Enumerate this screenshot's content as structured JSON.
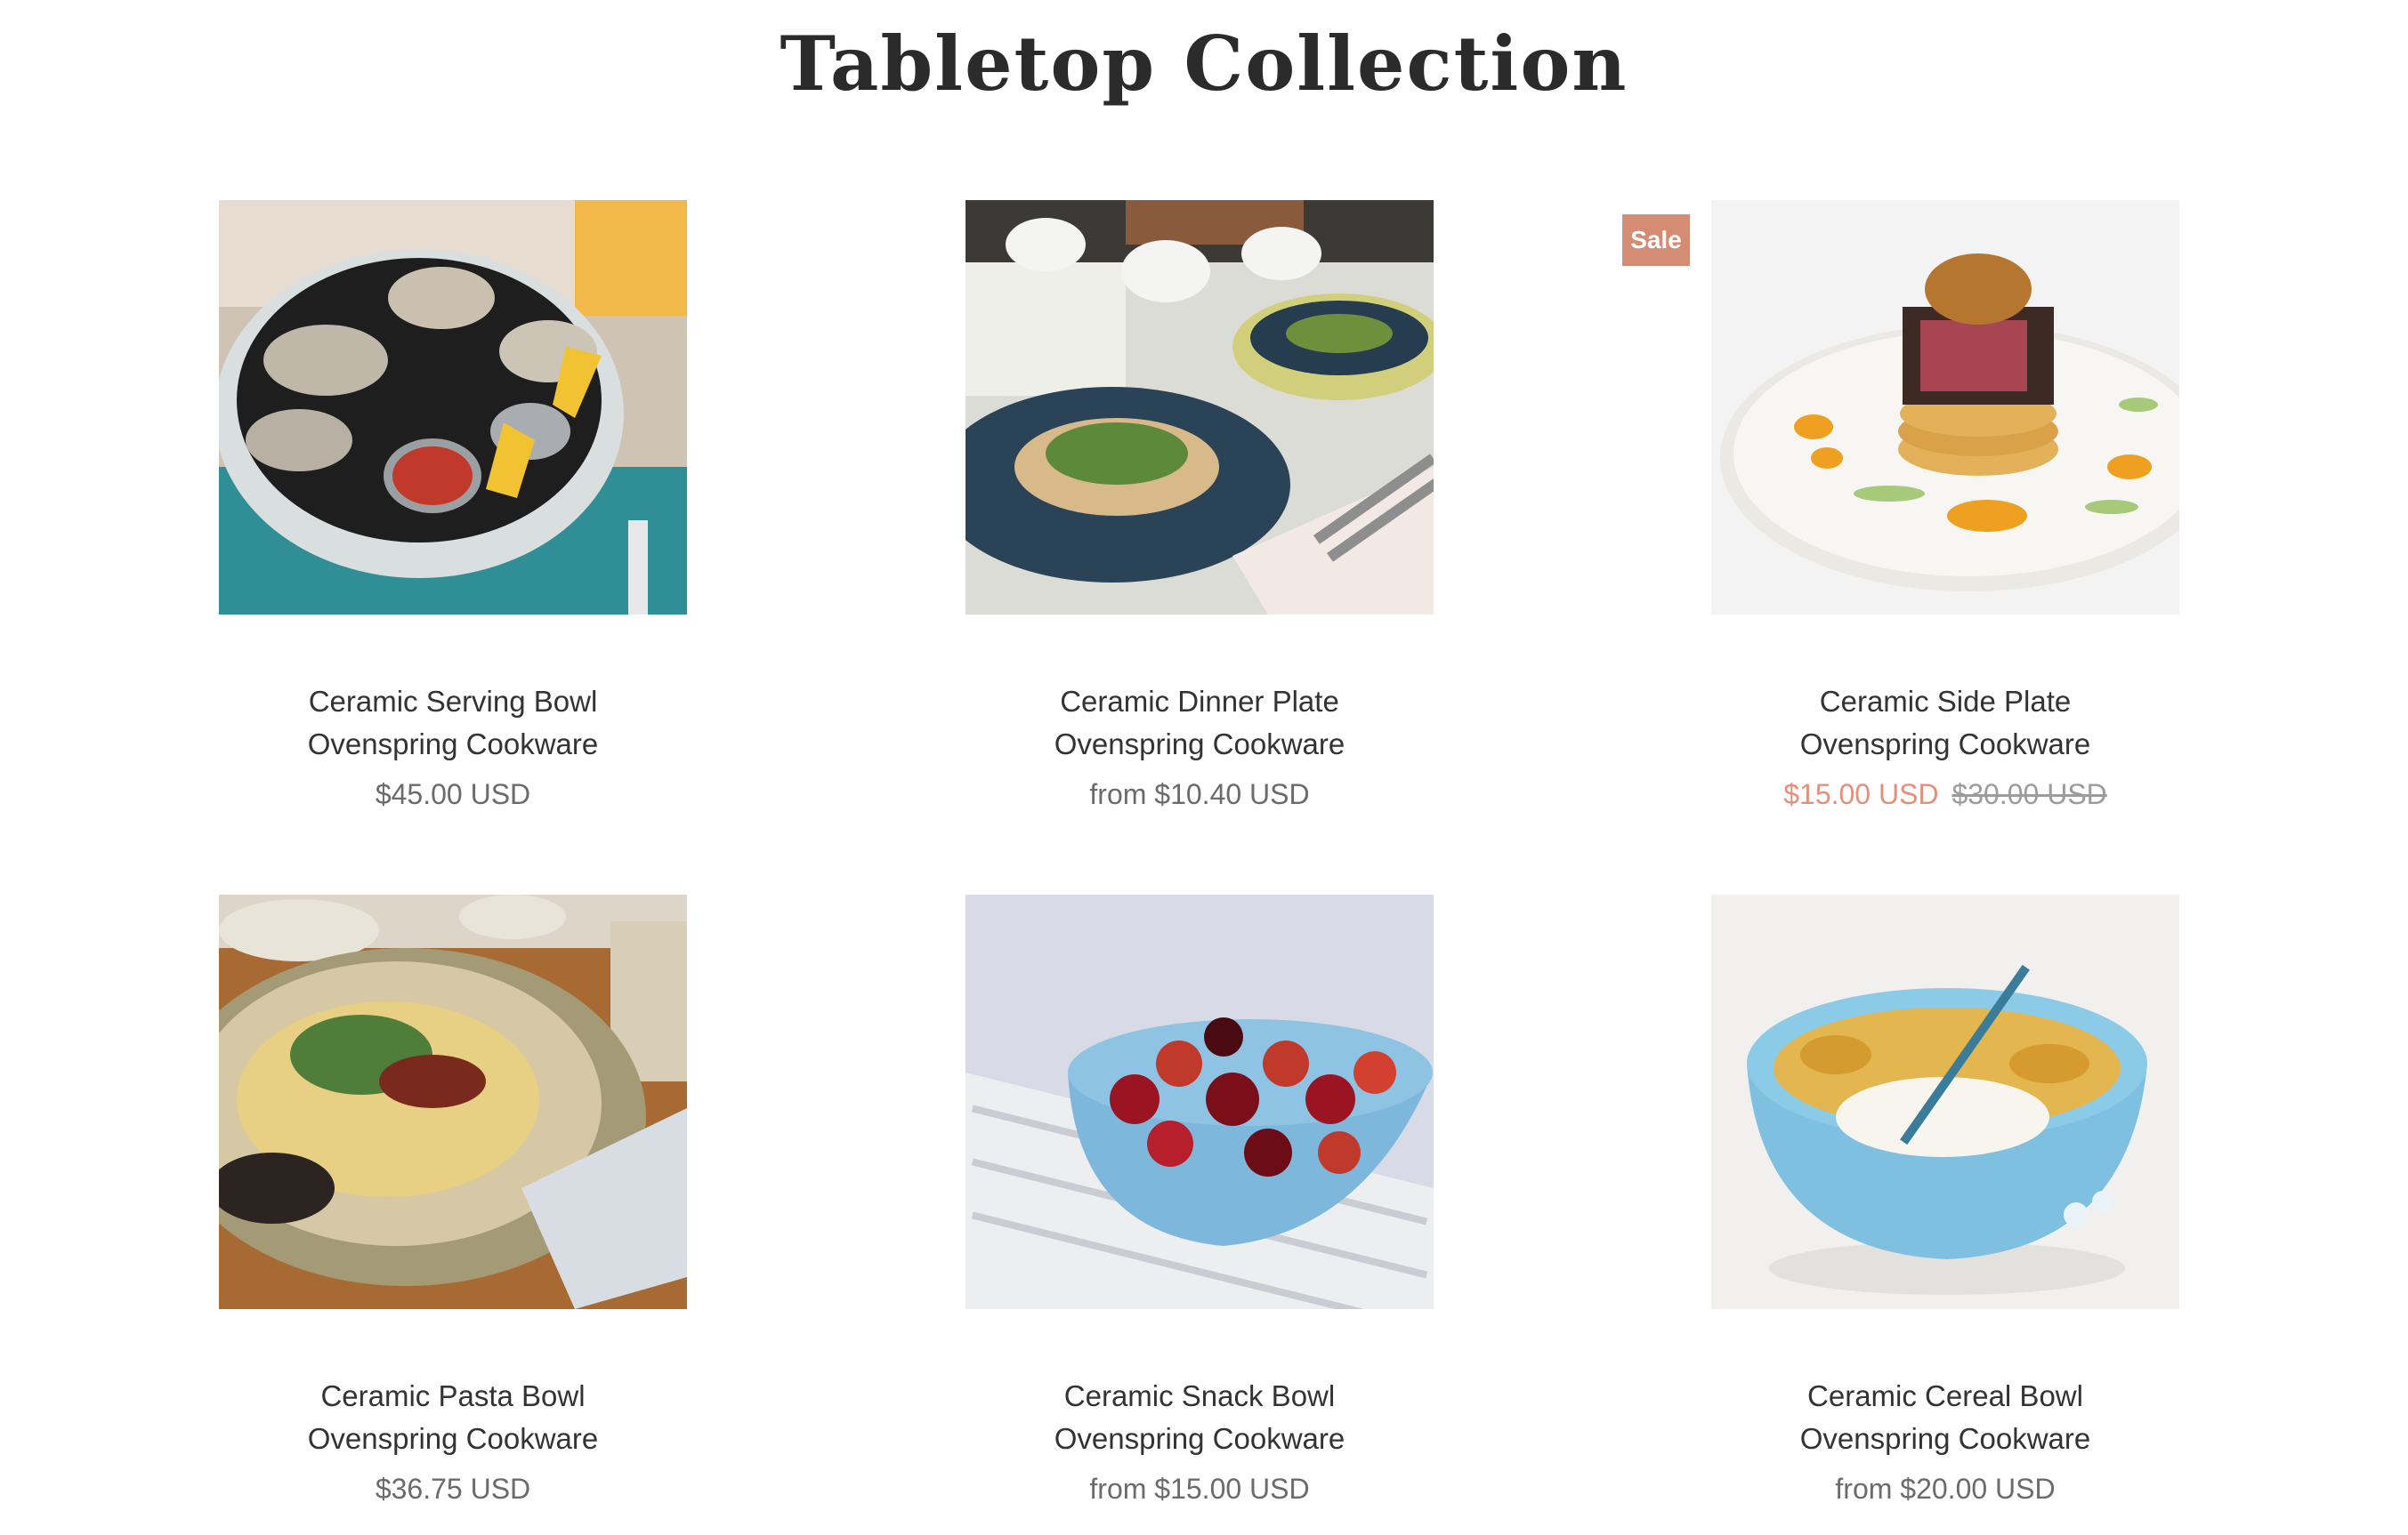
{
  "page": {
    "title": "Tabletop Collection"
  },
  "colors": {
    "sale_badge_bg": "#d58c75",
    "sale_price": "#e58f7a",
    "compare_price": "#9c9c9c",
    "text": "#333333",
    "price": "#6b6b6b"
  },
  "products": [
    {
      "title": "Ceramic Serving Bowl",
      "vendor": "Ovenspring Cookware",
      "price": "$45.00 USD"
    },
    {
      "title": "Ceramic Dinner Plate",
      "vendor": "Ovenspring Cookware",
      "price": "from $10.40 USD"
    },
    {
      "title": "Ceramic Side Plate",
      "vendor": "Ovenspring Cookware",
      "badge": "Sale",
      "sale_price": "$15.00 USD",
      "compare_price": "$30.00 USD"
    },
    {
      "title": "Ceramic Pasta Bowl",
      "vendor": "Ovenspring Cookware",
      "price": "$36.75 USD"
    },
    {
      "title": "Ceramic Snack Bowl",
      "vendor": "Ovenspring Cookware",
      "price": "from $15.00 USD"
    },
    {
      "title": "Ceramic Cereal Bowl",
      "vendor": "Ovenspring Cookware",
      "price": "from $20.00 USD"
    }
  ]
}
